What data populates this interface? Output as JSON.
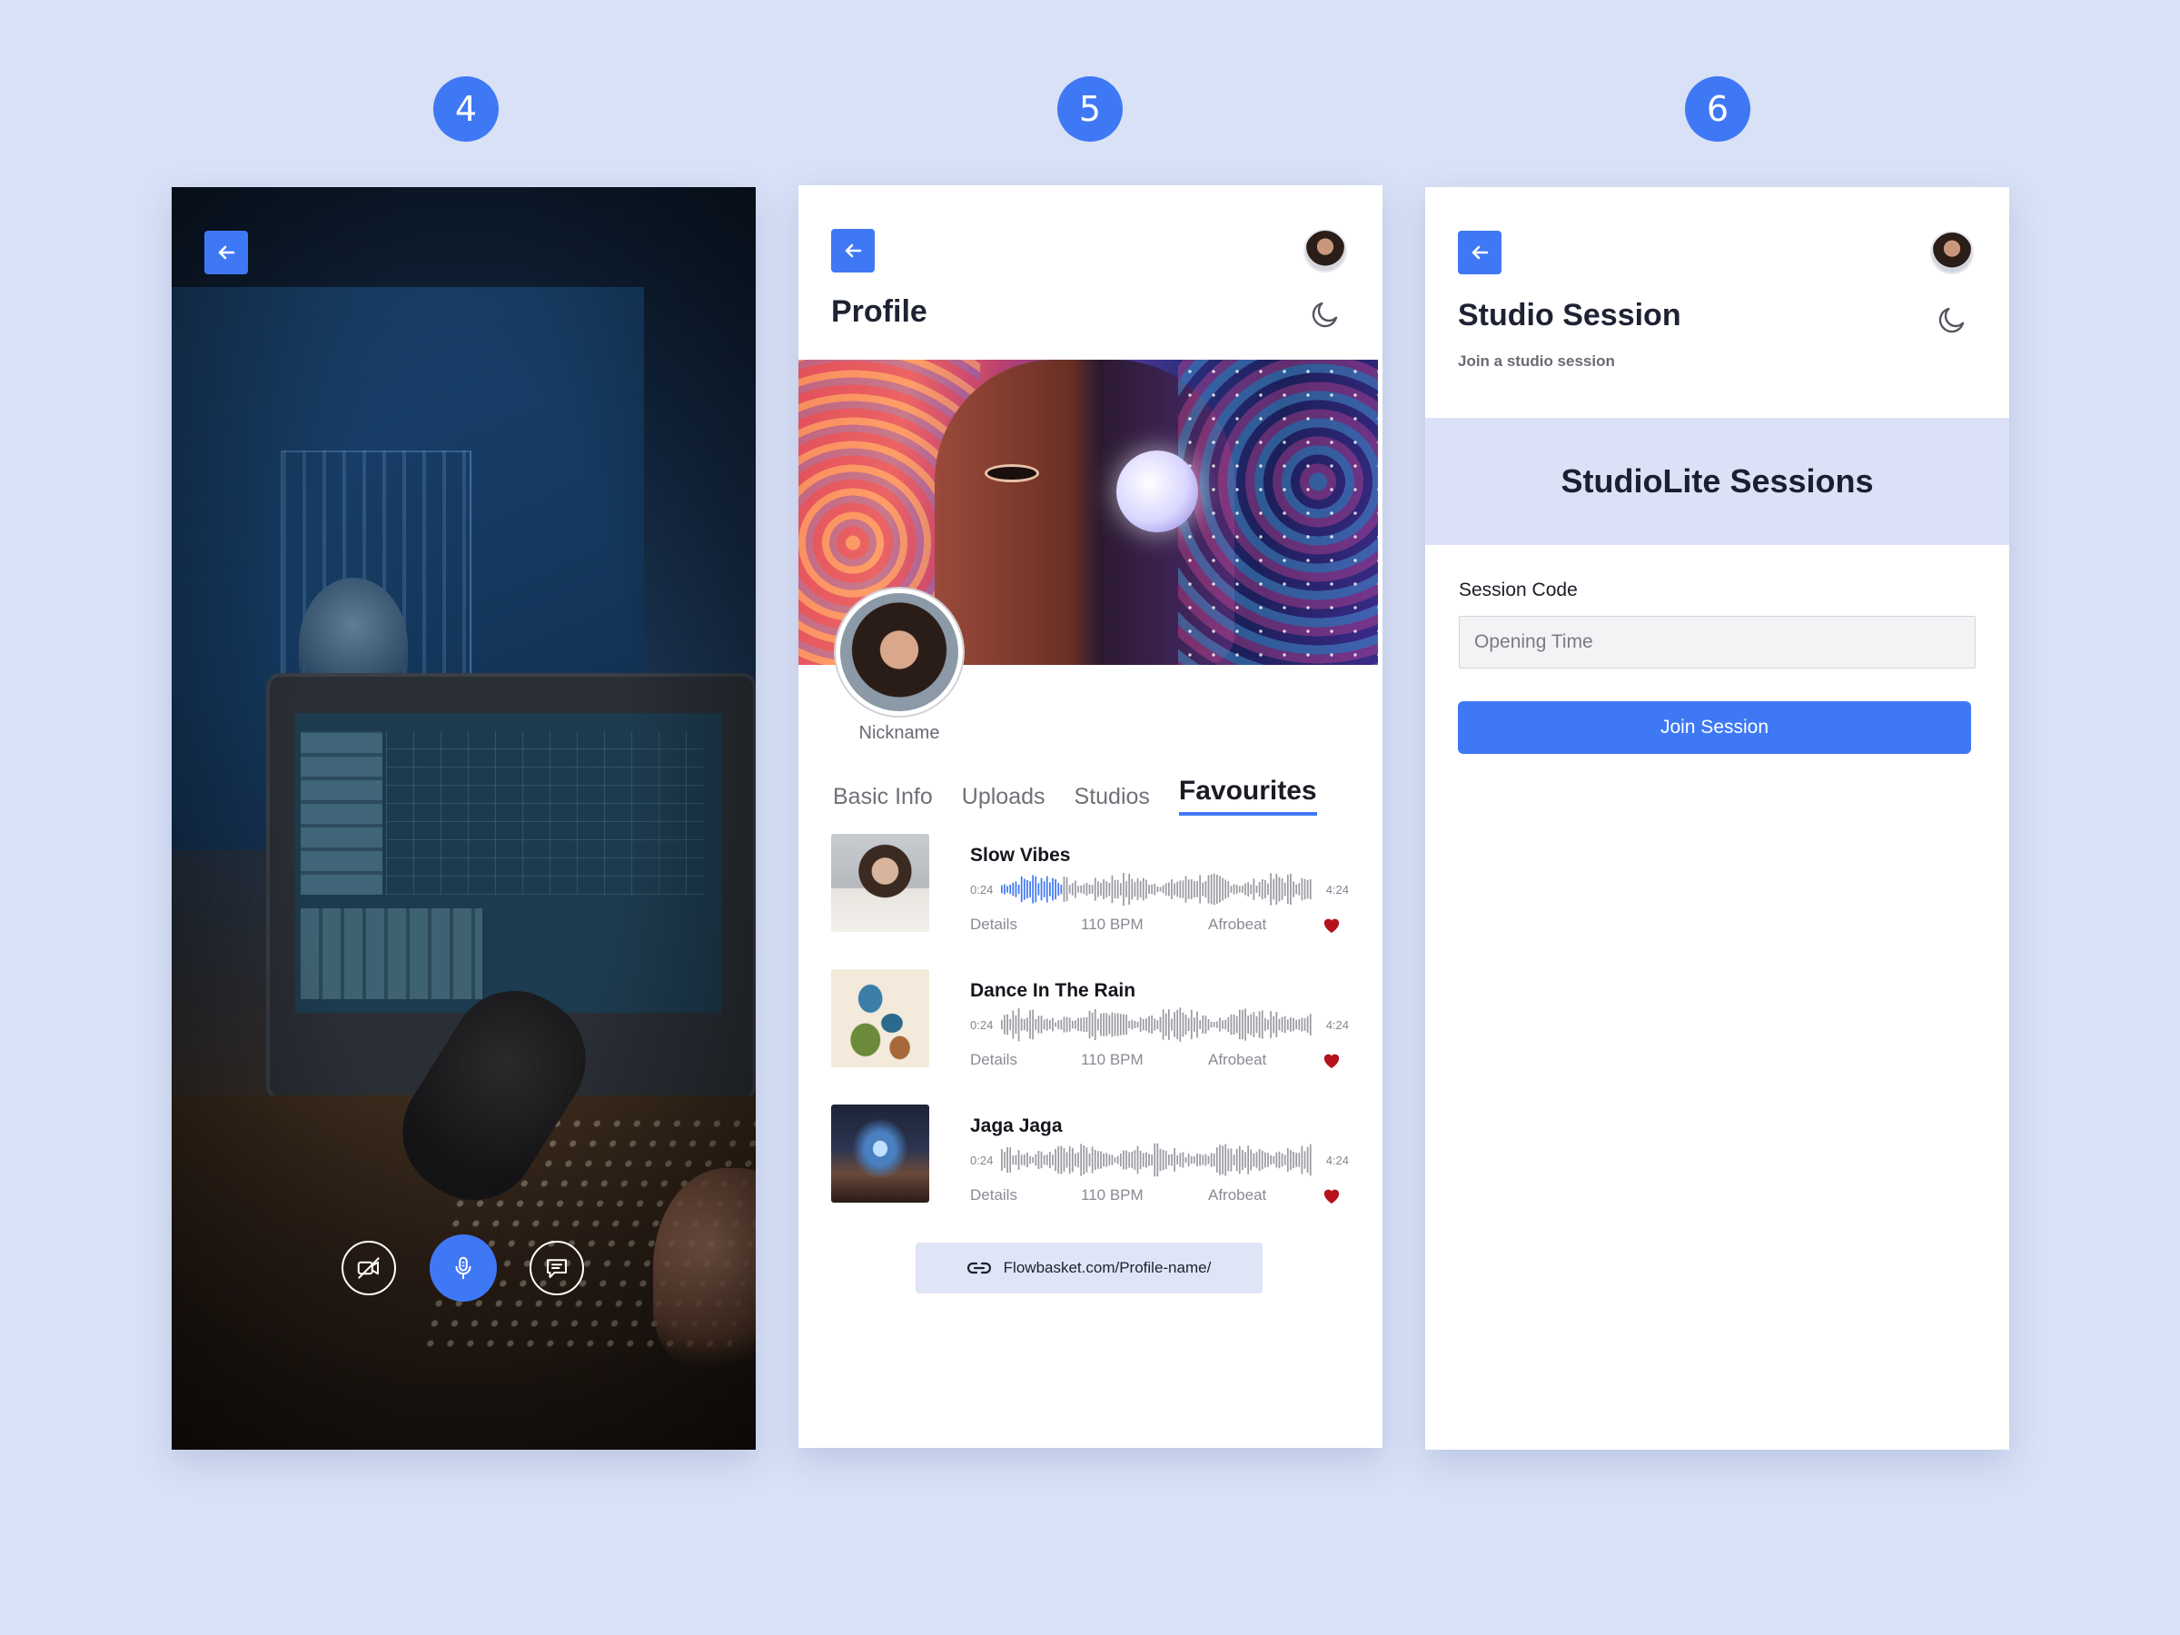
{
  "steps": {
    "s4": "4",
    "s5": "5",
    "s6": "6"
  },
  "profile": {
    "title": "Profile",
    "nickname": "Nickname",
    "tabs": [
      "Basic Info",
      "Uploads",
      "Studios",
      "Favourites"
    ],
    "active_tab": "Favourites",
    "tracks": [
      {
        "title": "Slow Vibes",
        "start": "0:24",
        "end": "4:24",
        "details": "Details",
        "bpm": "110 BPM",
        "genre": "Afrobeat",
        "progress": 0.2
      },
      {
        "title": "Dance In The Rain",
        "start": "0:24",
        "end": "4:24",
        "details": "Details",
        "bpm": "110 BPM",
        "genre": "Afrobeat",
        "progress": 0
      },
      {
        "title": "Jaga Jaga",
        "start": "0:24",
        "end": "4:24",
        "details": "Details",
        "bpm": "110 BPM",
        "genre": "Afrobeat",
        "progress": 0
      }
    ],
    "link": "Flowbasket.com/Profile-name/"
  },
  "session": {
    "title": "Studio Session",
    "subtitle": "Join a studio session",
    "band_title": "StudioLite Sessions",
    "field_label": "Session Code",
    "placeholder": "Opening Time",
    "join_label": "Join Session"
  },
  "colors": {
    "accent": "#3f78f5",
    "heart": "#b5121b",
    "wave": "#9a9aa2"
  },
  "icons": {
    "back": "arrow-left-icon",
    "video_off": "video-off-icon",
    "mic": "microphone-icon",
    "chat": "chat-icon",
    "moon": "moon-icon",
    "heart": "heart-icon",
    "link": "link-icon"
  }
}
